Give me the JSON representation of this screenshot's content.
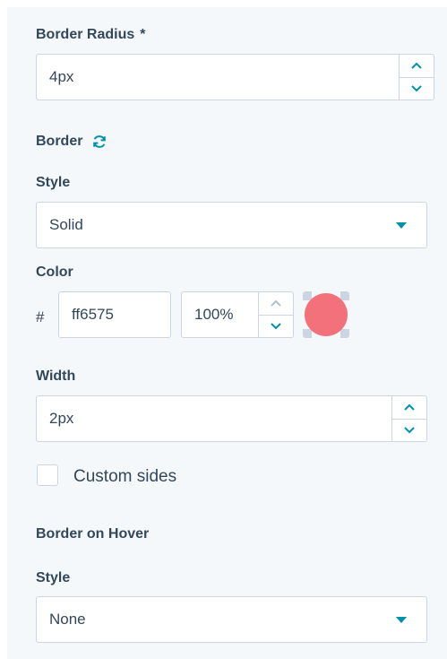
{
  "border_radius": {
    "label": "Border Radius",
    "required_mark": "*",
    "value": "4px"
  },
  "border": {
    "section_label": "Border",
    "refresh_icon": "refresh-icon",
    "style_label": "Style",
    "style_value": "Solid",
    "color_label": "Color",
    "hash": "#",
    "color_hex": "ff6575",
    "opacity": "100%",
    "swatch_color": "#f2717a",
    "width_label": "Width",
    "width_value": "2px",
    "custom_sides_label": "Custom sides",
    "custom_sides_checked": false
  },
  "border_hover": {
    "section_label": "Border on Hover",
    "style_label": "Style",
    "style_value": "None"
  },
  "colors": {
    "accent": "#0091ae",
    "text": "#33475b",
    "panel_bg": "#f5f8fa",
    "field_border": "#cbd6e2"
  }
}
